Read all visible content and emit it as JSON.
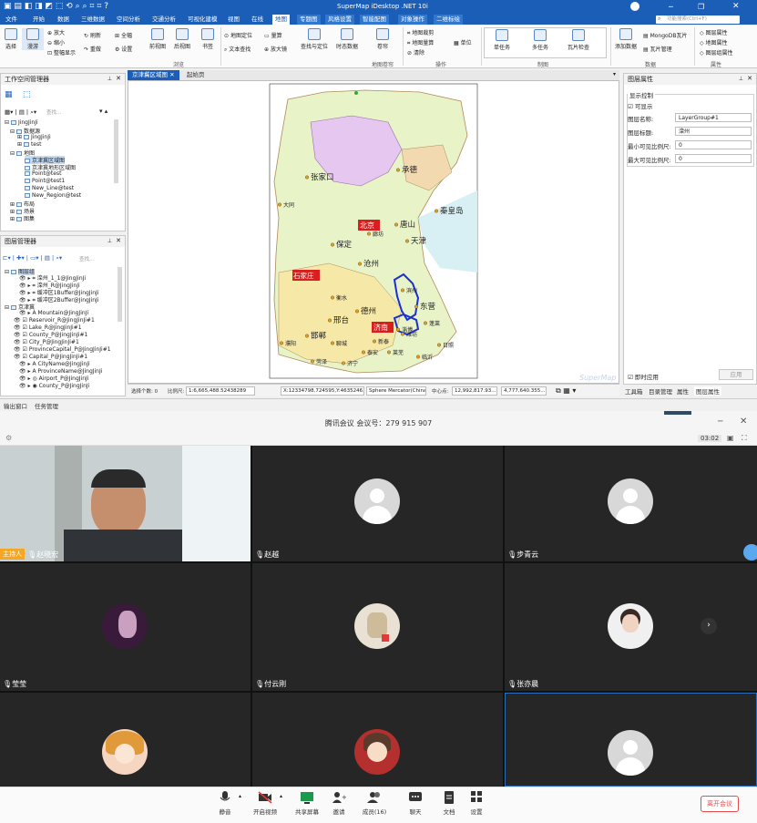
{
  "app": {
    "title": "SuperMap iDesktop .NET 10i",
    "search_placeholder": "功能搜索(Ctrl+F)",
    "ribbon_tabs": [
      "文件",
      "开始",
      "数据",
      "三维数据",
      "空间分析",
      "交通分析",
      "可视化建模",
      "视图",
      "在线",
      "地图",
      "专题图",
      "风格设置",
      "智能配图",
      "对象操作",
      "二维标绘"
    ],
    "active_tab": "地图",
    "ribbon": {
      "browse": {
        "select": "选择",
        "pan": "漫游",
        "zoom_in": "放大",
        "zoom_out": "缩小",
        "refresh": "刷新",
        "full": "全幅",
        "prev": "前视图",
        "next": "后视图",
        "bookmark": "书签",
        "settings": "设置",
        "entire": "整幅显示",
        "group": "浏览"
      },
      "mapops": {
        "locate": "地图定位",
        "measure": "量算",
        "text_search": "文本查找",
        "magnifier": "放大镜",
        "find": "查找与定位",
        "time": "时态数据",
        "bookmark2": "卷帘",
        "pro": "地图卷帘",
        "group": "操作"
      },
      "crop": {
        "a": "地图裁剪",
        "b": "地图量算",
        "c": "清除",
        "unit": "单位"
      },
      "cache": {
        "single": "单任务",
        "multi": "多任务",
        "tile": "瓦片检查",
        "group": "制图"
      },
      "data": {
        "add": "添加数据",
        "mongo": "MongoDB瓦片",
        "tilemgr": "瓦片管理",
        "group": "数据"
      },
      "prop": {
        "a": "图层属性",
        "b": "地图属性",
        "c": "图层组属性",
        "group": "属性"
      }
    },
    "workspace": {
      "title": "工作空间管理器",
      "search_placeholder": "查找...",
      "tree": [
        "JingJinJi",
        "数据源",
        "JingJinJi",
        "test",
        "地图",
        "京津冀区域图",
        "京津冀地形区域图",
        "Point@test",
        "Point@test1",
        "New_Line@test",
        "New_Region@test",
        "布局",
        "场景",
        "图集"
      ]
    },
    "layers": {
      "title": "图层管理器",
      "search_placeholder": "查找...",
      "items": [
        "图层组",
        "滦州_1_1@JingJinJi",
        "滦州_R@JingJinJi",
        "缓冲区1Buffer@JingJinJi",
        "缓冲区2Buffer@JingJinJi",
        "京津冀",
        "Mountain@JingJinJi",
        "Reservoir_R@JingJinJi#1",
        "Lake_R@JingJinJi#1",
        "County_P@JingJinJi#1",
        "City_P@JingJinJi#1",
        "ProvinceCapital_P@JingJinJi#1",
        "Capital_P@JingJinJi#1",
        "CityName@JingJinJi",
        "ProvinceName@JingJinJi",
        "Airport_P@JingJinJi",
        "County_P@JingJinJi"
      ]
    },
    "doc_tabs": [
      "京津冀区域图",
      "起始页"
    ],
    "map_labels": {
      "capital": "北京",
      "prov1": "石家庄",
      "prov2": "济南",
      "cities": [
        "张家口",
        "承德",
        "秦皇岛",
        "唐山",
        "天津",
        "保定",
        "沧州",
        "邢台",
        "邯郸",
        "德州",
        "东营",
        "滨州",
        "淄博",
        "潍坊",
        "聊城",
        "泰安",
        "莱芜",
        "衡水",
        "廊坊",
        "大同",
        "濮阳",
        "菏泽",
        "济宁",
        "临沂",
        "日照",
        "新泰",
        "蓬莱"
      ],
      "watermark": "SuperMap"
    },
    "status": {
      "selected": "选择个数: 0",
      "scale_label": "比例尺:",
      "scale": "1:6,665,488.52438289",
      "coords": "X:12334798.724595,Y:4635246...",
      "projection": "Sphere Mercator(China 2000)",
      "center_label": "中心点:",
      "cx": "12,992,817.93...",
      "cy": "4,777,640.355..."
    },
    "props": {
      "title": "图层属性",
      "section": "显示控制",
      "visible": "可显示",
      "name_label": "图层名称:",
      "name_value": "LayerGroup#1",
      "caption_label": "图层标题:",
      "caption_value": "滦州",
      "min_label": "最小可见比例尺:",
      "min_value": "0",
      "max_label": "最大可见比例尺:",
      "max_value": "0",
      "apply_now": "即时应用",
      "apply": "应用",
      "tabs": [
        "工具箱",
        "目录管理",
        "属性",
        "图层属性"
      ]
    },
    "bottom_tabs": [
      "输出窗口",
      "任务管理"
    ]
  },
  "meeting": {
    "title": "腾讯会议 会议号：279 915 907",
    "timer": "03:02",
    "host_badge": "主持人",
    "participants": [
      "赵晓宏",
      "赵越",
      "步青云",
      "莹莹",
      "付云刚",
      "张亦晨",
      "",
      "",
      ""
    ],
    "toolbar": [
      "静音",
      "开启视频",
      "共享屏幕",
      "邀请",
      "成员(16)",
      "聊天",
      "文档",
      "设置"
    ],
    "leave": "离开会议"
  }
}
